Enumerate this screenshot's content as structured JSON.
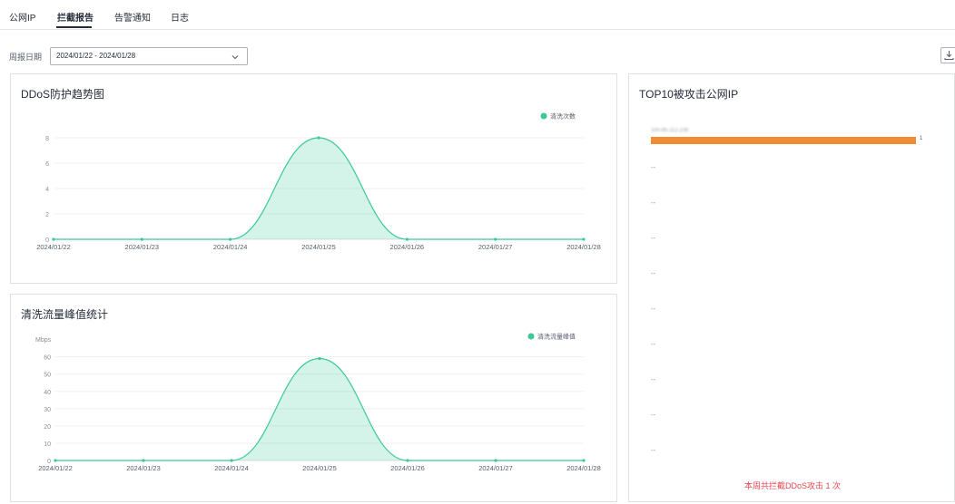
{
  "tabs": [
    {
      "label": "公网IP"
    },
    {
      "label": "拦截报告"
    },
    {
      "label": "告警通知"
    },
    {
      "label": "日志"
    }
  ],
  "filter": {
    "label": "周报日期",
    "value": "2024/01/22 - 2024/01/28"
  },
  "icons": {
    "chevron": "chevron-down-icon",
    "download": "download-icon"
  },
  "colors": {
    "series": "#3cc89b",
    "bar": "#f08c36",
    "summary": "#e6464e"
  },
  "trend_card": {
    "title": "DDoS防护趋势图"
  },
  "peak_card": {
    "title": "清洗流量峰值统计"
  },
  "top10": {
    "title": "TOP10被攻击公网IP",
    "rows": [
      {
        "ip": "100.85.112.239",
        "count": 1
      }
    ],
    "empty_placeholder": "--",
    "empty_count": 9,
    "summary": "本周共拦截DDoS攻击 1 次"
  },
  "chart_data": [
    {
      "type": "area",
      "title": "DDoS防护趋势图",
      "x": [
        "2024/01/22",
        "2024/01/23",
        "2024/01/24",
        "2024/01/25",
        "2024/01/26",
        "2024/01/27",
        "2024/01/28"
      ],
      "series": [
        {
          "name": "清洗次数",
          "values": [
            0,
            0,
            0,
            8,
            0,
            0,
            0
          ]
        }
      ],
      "yticks": [
        0,
        2,
        4,
        6,
        8
      ],
      "ylim": [
        0,
        9
      ],
      "ylabel": "",
      "grid": true,
      "legend": "top-right"
    },
    {
      "type": "area",
      "title": "清洗流量峰值统计",
      "x": [
        "2024/01/22",
        "2024/01/23",
        "2024/01/24",
        "2024/01/25",
        "2024/01/26",
        "2024/01/27",
        "2024/01/28"
      ],
      "series": [
        {
          "name": "清洗流量峰值",
          "values": [
            0,
            0,
            0,
            59,
            0,
            0,
            0
          ]
        }
      ],
      "yticks": [
        0,
        10,
        20,
        30,
        40,
        50,
        60
      ],
      "ylim": [
        0,
        64
      ],
      "ylabel": "Mbps",
      "grid": true,
      "legend": "top-right"
    }
  ]
}
